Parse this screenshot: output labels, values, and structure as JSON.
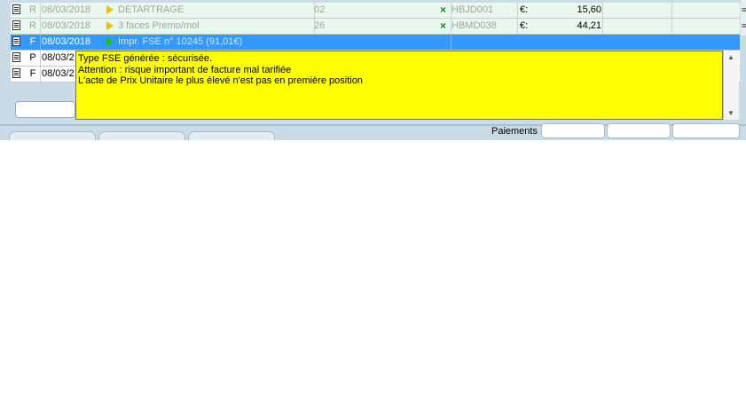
{
  "rows": [
    {
      "code": "R",
      "date": "08/03/2018",
      "label": "DETARTRAGE",
      "qty": "02",
      "ccam": "HBJD001",
      "currency": "€:",
      "amount": "15,60"
    },
    {
      "code": "R",
      "date": "08/03/2018",
      "label": "3 faces Premo/mol",
      "qty": "26",
      "ccam": "HBMD038",
      "currency": "€:",
      "amount": "44,21"
    },
    {
      "code": "F",
      "date": "08/03/2018",
      "label": "Impr. FSE n° 10245 (91,01€)"
    },
    {
      "code": "P",
      "date": "08/03/2"
    },
    {
      "code": "F",
      "date": "08/03/2"
    }
  ],
  "tooltip": {
    "line1": "Type FSE générée : sécurisée.",
    "line2": "Attention : risque important de facture mal tarifiée",
    "line3": "L'acte de Prix Unitaire le plus élevé n'est pas en première position"
  },
  "footer": {
    "paiements_label": "Paiements"
  },
  "icons": {
    "doc": "document-icon",
    "play_yellow": "play-yellow-icon",
    "play_green": "play-green-icon",
    "check": "x-mark-icon"
  },
  "colors": {
    "selection": "#3399ff",
    "tooltip_bg": "#ffff00",
    "row_done": "#eaf7ee"
  }
}
